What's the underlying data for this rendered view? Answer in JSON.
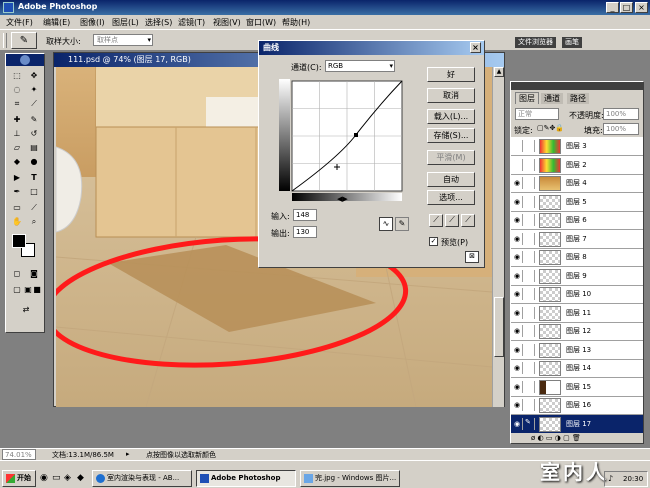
{
  "window": {
    "title": "Adobe Photoshop"
  },
  "menu": [
    "文件(F)",
    "编辑(E)",
    "图像(I)",
    "图层(L)",
    "选择(S)",
    "滤镜(T)",
    "视图(V)",
    "窗口(W)",
    "帮助(H)"
  ],
  "options": {
    "sample_label": "取样大小:",
    "sample_value": "取样点"
  },
  "palette_well": {
    "tab1": "文件浏览器",
    "tab2": "画笔"
  },
  "document": {
    "title": "111.psd @ 74% (图层 17, RGB)"
  },
  "curves": {
    "title": "曲线",
    "channel_label": "通道(C):",
    "channel_value": "RGB",
    "input_label": "输入:",
    "input_value": "148",
    "output_label": "输出:",
    "output_value": "130",
    "buttons": [
      "好",
      "取消",
      "载入(L)...",
      "存储(S)...",
      "平滑(M)",
      "自动",
      "选项..."
    ],
    "preview_label": "预览(P)",
    "preview_checked": true,
    "point": {
      "input": 148,
      "output": 130
    }
  },
  "layers_palette": {
    "tabs": [
      "图层",
      "通道",
      "路径"
    ],
    "blend_mode": "正常",
    "opacity_label": "不透明度:",
    "opacity_value": "100%",
    "lock_label": "锁定:",
    "fill_label": "填充:",
    "fill_value": "100%",
    "layers": [
      {
        "name": "图层 3",
        "visible": false,
        "thumb": "stripe"
      },
      {
        "name": "图层 2",
        "visible": false,
        "thumb": "stripe"
      },
      {
        "name": "图层 4",
        "visible": true,
        "thumb": "wood"
      },
      {
        "name": "图层 5",
        "visible": true,
        "thumb": "empty"
      },
      {
        "name": "图层 6",
        "visible": true,
        "thumb": "empty"
      },
      {
        "name": "图层 7",
        "visible": true,
        "thumb": "empty"
      },
      {
        "name": "图层 8",
        "visible": true,
        "thumb": "empty"
      },
      {
        "name": "图层 9",
        "visible": true,
        "thumb": "empty"
      },
      {
        "name": "图层 10",
        "visible": true,
        "thumb": "empty"
      },
      {
        "name": "图层 11",
        "visible": true,
        "thumb": "empty"
      },
      {
        "name": "图层 12",
        "visible": true,
        "thumb": "empty"
      },
      {
        "name": "图层 13",
        "visible": true,
        "thumb": "empty"
      },
      {
        "name": "图层 14",
        "visible": true,
        "thumb": "empty"
      },
      {
        "name": "图层 15",
        "visible": true,
        "thumb": "dark"
      },
      {
        "name": "图层 16",
        "visible": true,
        "thumb": "empty"
      },
      {
        "name": "图层 17",
        "visible": true,
        "thumb": "empty",
        "selected": true
      }
    ]
  },
  "status": {
    "zoom": "74.01%",
    "doc_size": "文档:13.1M/86.5M",
    "hint": "点按图像以选取新颜色"
  },
  "taskbar": {
    "start": "开始",
    "tasks": [
      "室内渲染与表现 - AB...",
      "Adobe Photoshop",
      "完.jpg - Windows 图片..."
    ],
    "clock": "20:30",
    "watermark": "室内人"
  },
  "colors": {
    "title_blue": "#0a246a",
    "selection": "#0a246a",
    "annotation_red": "#ff1a1a"
  }
}
